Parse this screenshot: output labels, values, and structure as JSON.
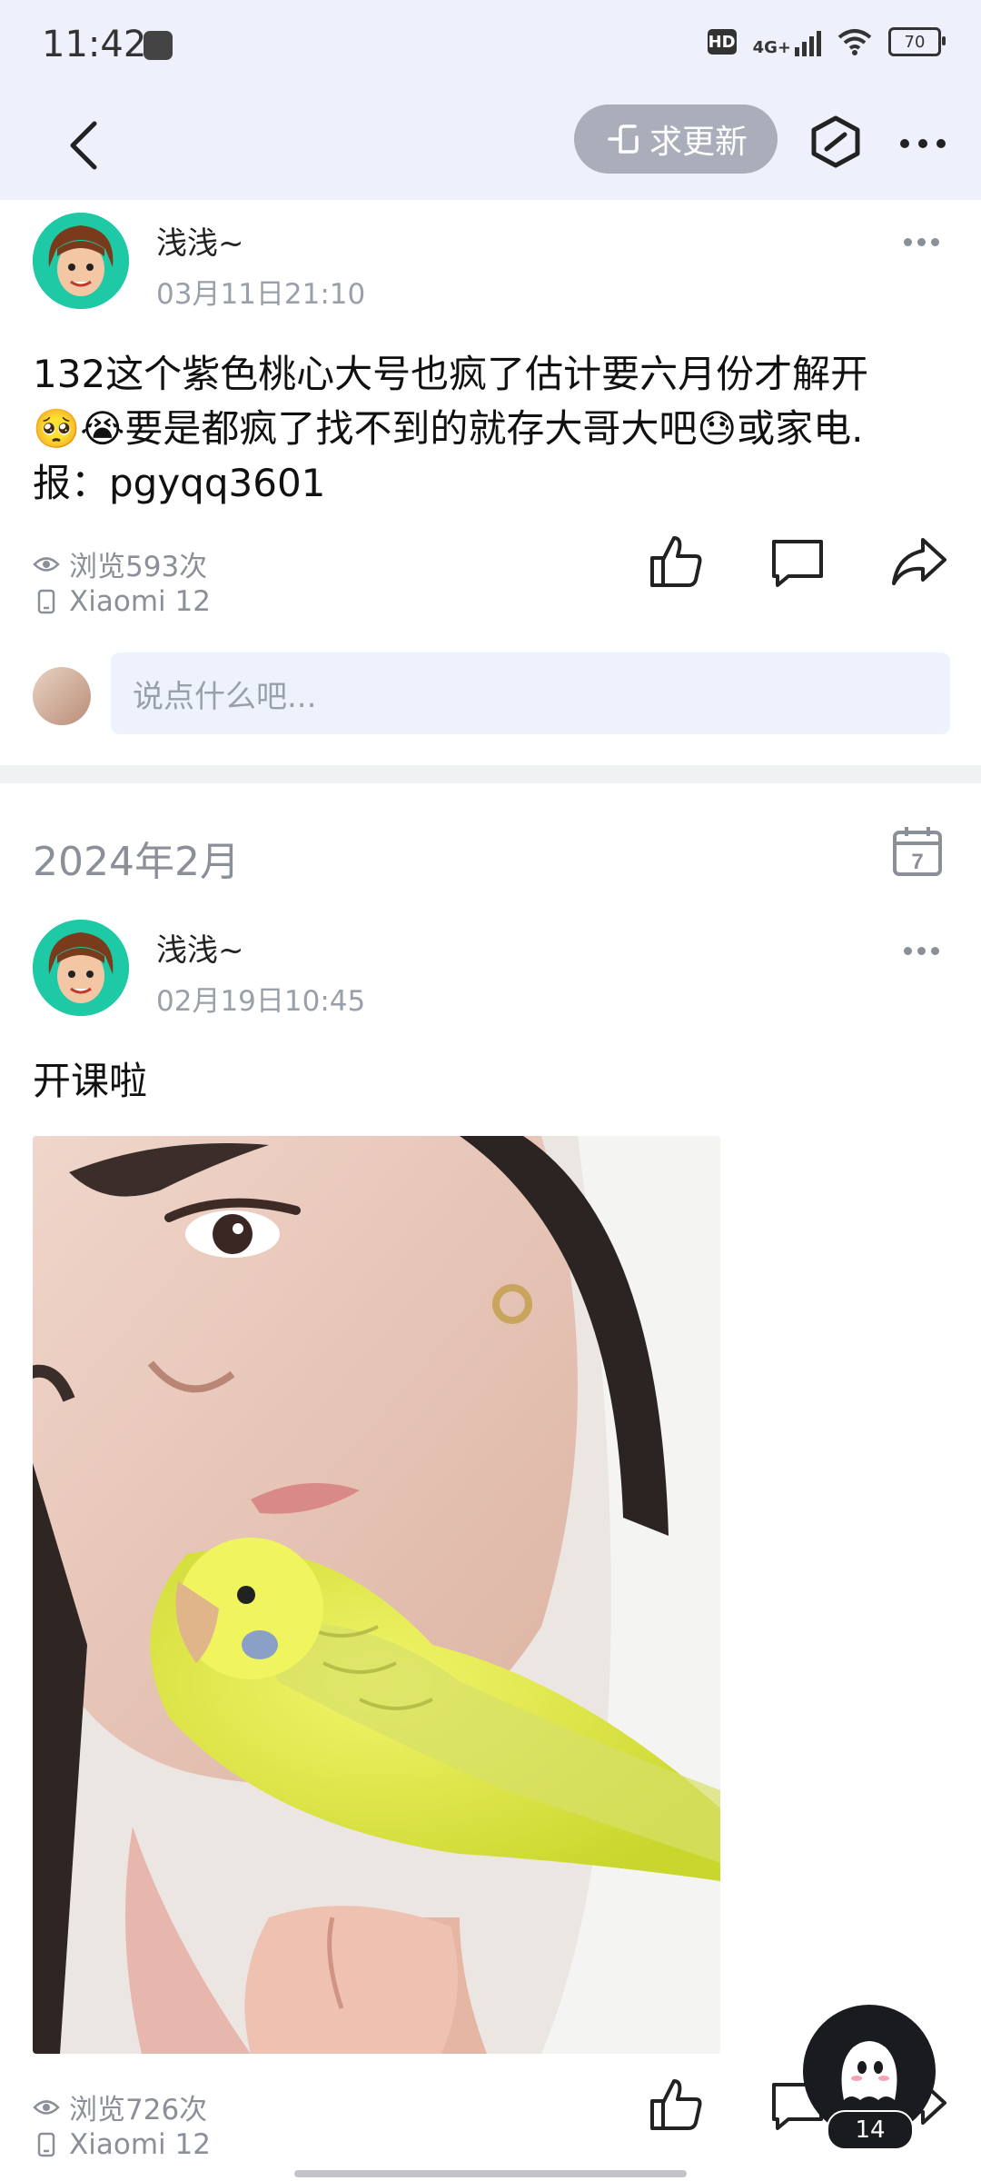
{
  "status_bar": {
    "time": "11:42",
    "network": "4G+",
    "battery": "70"
  },
  "nav": {
    "request_update_label": "求更新"
  },
  "posts": [
    {
      "username": "浅浅~",
      "timestamp": "03月11日21:10",
      "text_line1": "132这个紫色桃心大号也疯了估计要六月份才解开",
      "text_line2": "🥺😭要是都疯了找不到的就存大哥大吧😓或家电.",
      "text_line3": "报：pgyqq3601",
      "views": "浏览593次",
      "device": "Xiaomi 12",
      "comment_placeholder": "说点什么吧..."
    },
    {
      "username": "浅浅~",
      "timestamp": "02月19日10:45",
      "text": "开课啦",
      "views": "浏览726次",
      "device": "Xiaomi 12"
    }
  ],
  "section": {
    "month_title": "2024年2月",
    "calendar_day": "7"
  },
  "fab": {
    "badge": "14"
  },
  "colors": {
    "header_bg": "#eef1fc",
    "muted_text": "#8b8f98",
    "avatar_bg": "#1ec9a6"
  }
}
